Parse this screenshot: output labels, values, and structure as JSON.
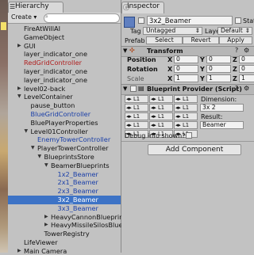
{
  "hierarchy": {
    "tab_label": "Hierarchy",
    "create_label": "Create ▾",
    "search_icon": "magnifier",
    "rows": [
      {
        "label": "FireAtWillAI",
        "indent": 0,
        "arrow": "",
        "style": "normal"
      },
      {
        "label": "GameObject",
        "indent": 0,
        "arrow": "",
        "style": "normal"
      },
      {
        "label": "GUI",
        "indent": 0,
        "arrow": "▶",
        "style": "normal"
      },
      {
        "label": "layer_indicator_one",
        "indent": 0,
        "arrow": "",
        "style": "normal"
      },
      {
        "label": "RedGridController",
        "indent": 0,
        "arrow": "",
        "style": "red"
      },
      {
        "label": "layer_indicator_one",
        "indent": 0,
        "arrow": "",
        "style": "normal"
      },
      {
        "label": "layer_indicator_one",
        "indent": 0,
        "arrow": "",
        "style": "normal"
      },
      {
        "label": "level02-back",
        "indent": 0,
        "arrow": "▶",
        "style": "normal"
      },
      {
        "label": "LevelContainer",
        "indent": 0,
        "arrow": "▼",
        "style": "normal"
      },
      {
        "label": "pause_button",
        "indent": 1,
        "arrow": "",
        "style": "normal"
      },
      {
        "label": "BlueGridController",
        "indent": 1,
        "arrow": "",
        "style": "blue"
      },
      {
        "label": "BluePlayerProperties",
        "indent": 1,
        "arrow": "",
        "style": "normal"
      },
      {
        "label": "Level01Controller",
        "indent": 1,
        "arrow": "▼",
        "style": "normal"
      },
      {
        "label": "EnemyTowerController",
        "indent": 2,
        "arrow": "",
        "style": "blue"
      },
      {
        "label": "PlayerTowerController",
        "indent": 2,
        "arrow": "▼",
        "style": "normal"
      },
      {
        "label": "BlueprintsStore",
        "indent": 3,
        "arrow": "▼",
        "style": "normal"
      },
      {
        "label": "BeamerBlueprints",
        "indent": 4,
        "arrow": "▼",
        "style": "normal"
      },
      {
        "label": "1x2_Beamer",
        "indent": 5,
        "arrow": "",
        "style": "blue"
      },
      {
        "label": "2x1_Beamer",
        "indent": 5,
        "arrow": "",
        "style": "blue"
      },
      {
        "label": "2x3_Beamer",
        "indent": 5,
        "arrow": "",
        "style": "blue"
      },
      {
        "label": "3x2_Beamer",
        "indent": 5,
        "arrow": "",
        "style": "selected"
      },
      {
        "label": "3x3_Beamer",
        "indent": 5,
        "arrow": "",
        "style": "blue"
      },
      {
        "label": "HeavyCannonBlueprin",
        "indent": 4,
        "arrow": "▶",
        "style": "normal"
      },
      {
        "label": "HeavyMissileSilosBlue",
        "indent": 4,
        "arrow": "▶",
        "style": "normal"
      },
      {
        "label": "TowerRegistry",
        "indent": 3,
        "arrow": "",
        "style": "normal"
      },
      {
        "label": "LifeViewer",
        "indent": 0,
        "arrow": "",
        "style": "normal"
      },
      {
        "label": "Main Camera",
        "indent": 0,
        "arrow": "▶",
        "style": "normal"
      }
    ]
  },
  "inspector": {
    "tab_label": "Inspector",
    "object_name": "3x2_Beamer",
    "static_label": "Static",
    "tag_label": "Tag",
    "tag_value": "Untagged",
    "layer_label": "Layer",
    "layer_value": "Default",
    "prefab_label": "Prefab",
    "prefab_buttons": [
      "Select",
      "Revert",
      "Apply"
    ],
    "transform": {
      "title": "Transform",
      "rows": [
        {
          "label": "Position",
          "x": "0",
          "y": "0",
          "z": "0"
        },
        {
          "label": "Rotation",
          "x": "0",
          "y": "0",
          "z": "0"
        },
        {
          "label": "Scale",
          "x": "1",
          "y": "1",
          "z": "1"
        }
      ],
      "axis_labels": [
        "X",
        "Y",
        "Z"
      ]
    },
    "blueprint": {
      "title": "Blueprint Provider (Script)",
      "dimension_label": "Dimension:",
      "dimension_value": "3x 2",
      "result_label": "Result:",
      "result_value": "Beamer",
      "stepper_value": "L1",
      "debug_label": "Debug info shown?"
    },
    "add_component_label": "Add Component"
  },
  "colors": {
    "selection": "#3d73c6",
    "prefab_blue": "#1a3fa8",
    "missing_red": "#b02020",
    "panel_bg": "#c2c2c2"
  }
}
